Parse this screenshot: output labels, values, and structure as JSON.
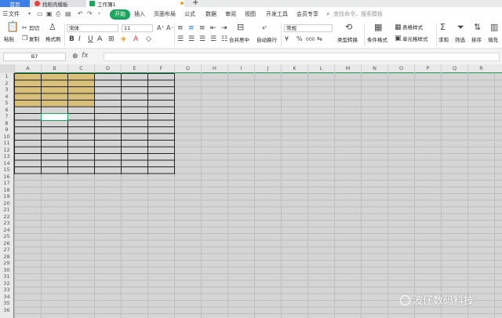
{
  "tabs": {
    "home": "首页",
    "template": "找稻壳模板",
    "workbook": "工作簿1",
    "new_tab": "+"
  },
  "menu": {
    "file": "文件",
    "items": [
      "开始",
      "插入",
      "页面布局",
      "公式",
      "数据",
      "审阅",
      "视图",
      "开发工具",
      "会员专享"
    ],
    "search_placeholder": "查找命令、搜索模板"
  },
  "ribbon": {
    "paste": "粘贴",
    "cut": "剪切",
    "copy": "复制",
    "format_painter": "格式刷",
    "font_name": "宋体",
    "font_size": "11",
    "bold": "B",
    "italic": "I",
    "underline": "U",
    "merge_center": "合并居中",
    "wrap_text": "自动换行",
    "number_format": "常规",
    "type_convert": "类型转换",
    "conditional_format": "条件格式",
    "table_style": "表格样式",
    "cell_style": "单元格样式",
    "sum": "求和",
    "filter": "筛选",
    "sort": "排序",
    "fill": "填充",
    "percent": "%",
    "thousands": "000"
  },
  "formula_bar": {
    "name_box": "B7",
    "fx": "fx",
    "value": ""
  },
  "grid": {
    "columns": [
      "A",
      "B",
      "C",
      "D",
      "E",
      "F",
      "G",
      "H",
      "I",
      "J",
      "K",
      "L",
      "M",
      "N",
      "O",
      "P",
      "Q",
      "R"
    ],
    "rows": [
      "1",
      "2",
      "3",
      "4",
      "5",
      "6",
      "7",
      "8",
      "9",
      "10",
      "11",
      "12",
      "13",
      "14",
      "15",
      "16",
      "17",
      "18",
      "19",
      "20",
      "21",
      "22",
      "23",
      "24",
      "25",
      "26",
      "27",
      "28",
      "29",
      "30",
      "31",
      "32",
      "33",
      "34",
      "35",
      "36"
    ],
    "active_cell": "B7",
    "highlight_color": "#d9c07a",
    "accent_color": "#1aa65c"
  },
  "watermark": "波仔数码科技"
}
